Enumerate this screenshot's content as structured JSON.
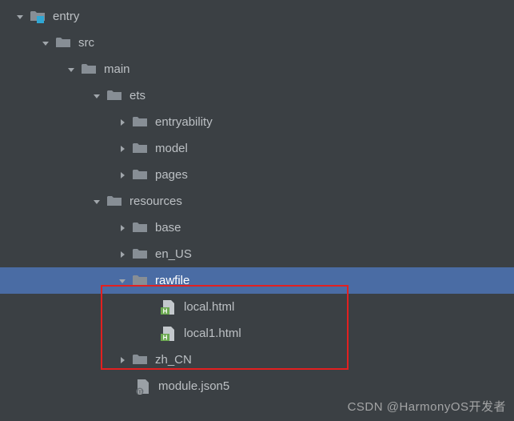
{
  "tree": {
    "rows": [
      {
        "indent": 16,
        "arrow": "down",
        "icon": "module-folder",
        "label": "entry",
        "selected": false
      },
      {
        "indent": 48,
        "arrow": "down",
        "icon": "folder",
        "label": "src",
        "selected": false
      },
      {
        "indent": 80,
        "arrow": "down",
        "icon": "folder",
        "label": "main",
        "selected": false
      },
      {
        "indent": 112,
        "arrow": "down",
        "icon": "folder",
        "label": "ets",
        "selected": false
      },
      {
        "indent": 144,
        "arrow": "right",
        "icon": "folder",
        "label": "entryability",
        "selected": false
      },
      {
        "indent": 144,
        "arrow": "right",
        "icon": "folder",
        "label": "model",
        "selected": false
      },
      {
        "indent": 144,
        "arrow": "right",
        "icon": "folder",
        "label": "pages",
        "selected": false
      },
      {
        "indent": 112,
        "arrow": "down",
        "icon": "folder",
        "label": "resources",
        "selected": false
      },
      {
        "indent": 144,
        "arrow": "right",
        "icon": "folder",
        "label": "base",
        "selected": false
      },
      {
        "indent": 144,
        "arrow": "right",
        "icon": "folder",
        "label": "en_US",
        "selected": false
      },
      {
        "indent": 144,
        "arrow": "down",
        "icon": "folder",
        "label": "rawfile",
        "selected": true
      },
      {
        "indent": 180,
        "arrow": "none",
        "icon": "html-file",
        "label": "local.html",
        "selected": false
      },
      {
        "indent": 180,
        "arrow": "none",
        "icon": "html-file",
        "label": "local1.html",
        "selected": false
      },
      {
        "indent": 144,
        "arrow": "right",
        "icon": "folder",
        "label": "zh_CN",
        "selected": false
      },
      {
        "indent": 148,
        "arrow": "none",
        "icon": "json5-file",
        "label": "module.json5",
        "selected": false
      }
    ]
  },
  "watermark": "CSDN @HarmonyOS开发者",
  "icons": {
    "folder_fill": "#878e95",
    "module_overlay": "#2fa7d4",
    "html_green": "#6aa84f",
    "html_letter": "H",
    "json_fill": "#878e95"
  }
}
